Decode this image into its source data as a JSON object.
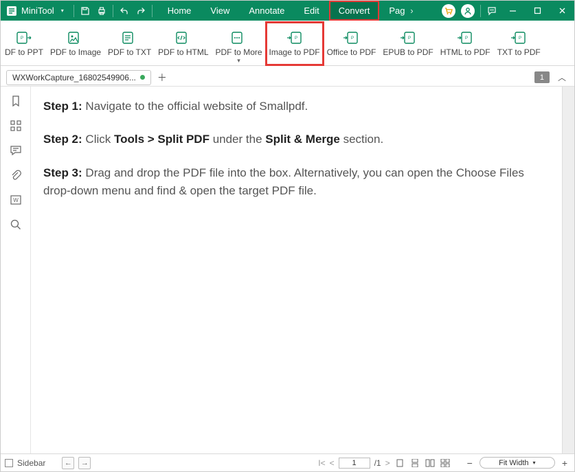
{
  "app": {
    "name": "MiniTool"
  },
  "menu": {
    "items": [
      "Home",
      "View",
      "Annotate",
      "Edit",
      "Convert",
      "Pag"
    ],
    "active_index": 4,
    "highlight_index": 4
  },
  "ribbon": {
    "items": [
      {
        "label": "DF to PPT"
      },
      {
        "label": "PDF to Image"
      },
      {
        "label": "PDF to TXT"
      },
      {
        "label": "PDF to HTML"
      },
      {
        "label": "PDF to More",
        "more": true
      },
      {
        "label": "Image to PDF",
        "highlight": true
      },
      {
        "label": "Office to PDF"
      },
      {
        "label": "EPUB to PDF"
      },
      {
        "label": "HTML to PDF"
      },
      {
        "label": "TXT to PDF"
      }
    ]
  },
  "tabs": {
    "items": [
      {
        "name": "WXWorkCapture_16802549906...",
        "modified": true
      }
    ],
    "page_badge": "1"
  },
  "content": {
    "step1_label": "Step 1:",
    "step1_text": " Navigate to the official website of Smallpdf.",
    "step2_label": "Step 2:",
    "step2_a": " Click ",
    "step2_b": "Tools > Split PDF",
    "step2_c": " under the ",
    "step2_d": "Split & Merge",
    "step2_e": " section.",
    "step3_label": "Step 3:",
    "step3_text": " Drag and drop the PDF file into the box. Alternatively, you can open the Choose Files drop-down menu and find & open the target PDF file."
  },
  "status": {
    "sidebar_label": "Sidebar",
    "page_current": "1",
    "page_total": "/1",
    "zoom_label": "Fit Width"
  },
  "colors": {
    "primary": "#0a8a5f",
    "highlight": "#e53935"
  }
}
